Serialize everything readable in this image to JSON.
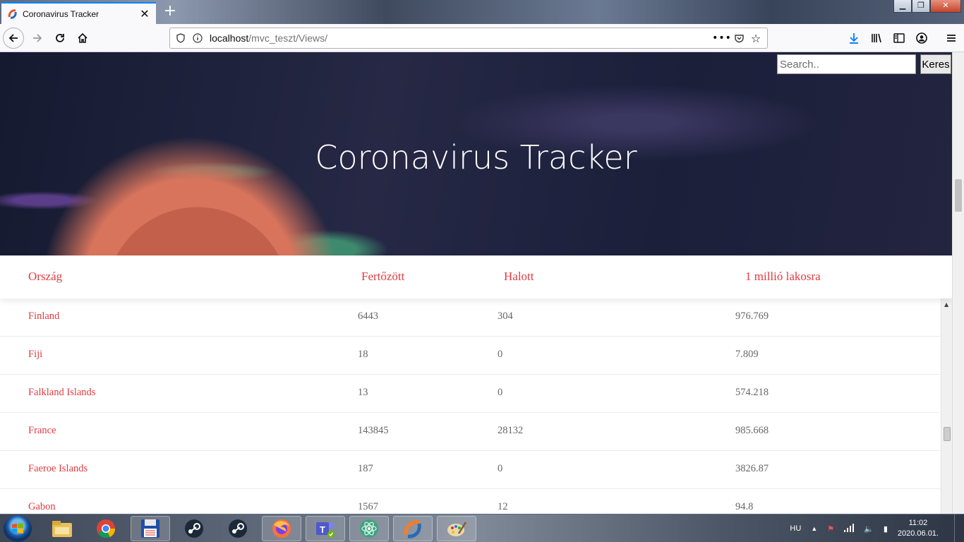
{
  "browser": {
    "tab_title": "Coronavirus Tracker",
    "url_host": "localhost",
    "url_path": "/mvc_teszt/Views/"
  },
  "page": {
    "hero_title": "Coronavirus Tracker",
    "search_placeholder": "Search..",
    "search_button": "Keres"
  },
  "table": {
    "headers": [
      "Ország",
      "Fertőzött",
      "Halott",
      "1 millió lakosra"
    ],
    "rows": [
      {
        "country": "Finland",
        "infected": "6443",
        "dead": "304",
        "per_million": "976.769"
      },
      {
        "country": "Fiji",
        "infected": "18",
        "dead": "0",
        "per_million": "7.809"
      },
      {
        "country": "Falkland Islands",
        "infected": "13",
        "dead": "0",
        "per_million": "574.218"
      },
      {
        "country": "France",
        "infected": "143845",
        "dead": "28132",
        "per_million": "985.668"
      },
      {
        "country": "Faeroe Islands",
        "infected": "187",
        "dead": "0",
        "per_million": "3826.87"
      },
      {
        "country": "Gabon",
        "infected": "1567",
        "dead": "12",
        "per_million": "94.8"
      }
    ]
  },
  "taskbar": {
    "apps": [
      "explorer-icon",
      "chrome-icon",
      "save-app-icon",
      "steam-icon",
      "steam-icon",
      "firefox-icon",
      "teams-icon",
      "atom-icon",
      "xampp-icon",
      "paint-icon"
    ],
    "language": "HU",
    "time": "11:02",
    "date": "2020.06.01."
  },
  "colors": {
    "accent_red": "#e13b41",
    "firefox_blue": "#0a84ff"
  }
}
